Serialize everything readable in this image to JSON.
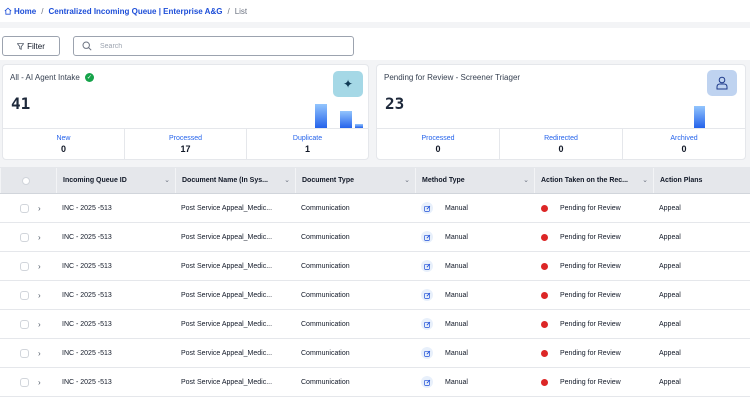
{
  "breadcrumb": {
    "home": "Home",
    "queue": "Centralized Incoming Queue | Enterprise A&G",
    "current": "List",
    "separator": "/"
  },
  "toolbar": {
    "filter_label": "Filter",
    "search_placeholder": "Search"
  },
  "cards": {
    "ai_intake": {
      "title": "All - AI Agent Intake",
      "count": "41",
      "stats": [
        {
          "label": "New",
          "value": "0"
        },
        {
          "label": "Processed",
          "value": "17"
        },
        {
          "label": "Duplicate",
          "value": "1"
        }
      ]
    },
    "pending_review": {
      "title": "Pending for Review - Screener Triager",
      "count": "23",
      "stats": [
        {
          "label": "Processed",
          "value": "0"
        },
        {
          "label": "Redirected",
          "value": "0"
        },
        {
          "label": "Archived",
          "value": "0"
        }
      ]
    }
  },
  "table": {
    "headers": [
      "Incoming Queue ID",
      "Document Name (In Sys...",
      "Document Type",
      "Method Type",
      "Action Taken on the Rec...",
      "Action Plans"
    ],
    "rows": [
      {
        "id": "INC - 2025 -513",
        "doc_name": "Post Service Appeal_Medic...",
        "doc_type": "Communication",
        "method": "Manual",
        "action": "Pending for Review",
        "plan": "Appeal"
      },
      {
        "id": "INC - 2025 -513",
        "doc_name": "Post Service Appeal_Medic...",
        "doc_type": "Communication",
        "method": "Manual",
        "action": "Pending for Review",
        "plan": "Appeal"
      },
      {
        "id": "INC - 2025 -513",
        "doc_name": "Post Service Appeal_Medic...",
        "doc_type": "Communication",
        "method": "Manual",
        "action": "Pending for Review",
        "plan": "Appeal"
      },
      {
        "id": "INC - 2025 -513",
        "doc_name": "Post Service Appeal_Medic...",
        "doc_type": "Communication",
        "method": "Manual",
        "action": "Pending for Review",
        "plan": "Appeal"
      },
      {
        "id": "INC - 2025 -513",
        "doc_name": "Post Service Appeal_Medic...",
        "doc_type": "Communication",
        "method": "Manual",
        "action": "Pending for Review",
        "plan": "Appeal"
      },
      {
        "id": "INC - 2025 -513",
        "doc_name": "Post Service Appeal_Medic...",
        "doc_type": "Communication",
        "method": "Manual",
        "action": "Pending for Review",
        "plan": "Appeal"
      },
      {
        "id": "INC - 2025 -513",
        "doc_name": "Post Service Appeal_Medic...",
        "doc_type": "Communication",
        "method": "Manual",
        "action": "Pending for Review",
        "plan": "Appeal"
      }
    ]
  },
  "icons": {
    "home": "home-icon",
    "filter": "filter-icon",
    "search": "search-icon",
    "sparkle": "sparkle-icon",
    "user": "user-icon",
    "check": "check-circle-icon",
    "edit": "edit-icon",
    "status": "status-dot-icon",
    "expand": "chevron-right-icon",
    "sort": "chevron-down-icon"
  },
  "colors": {
    "link": "#1d4ed8",
    "success": "#16a34a",
    "pending": "#dc2626",
    "bar_top": "#93c5fd",
    "bar_bottom": "#2563eb"
  }
}
